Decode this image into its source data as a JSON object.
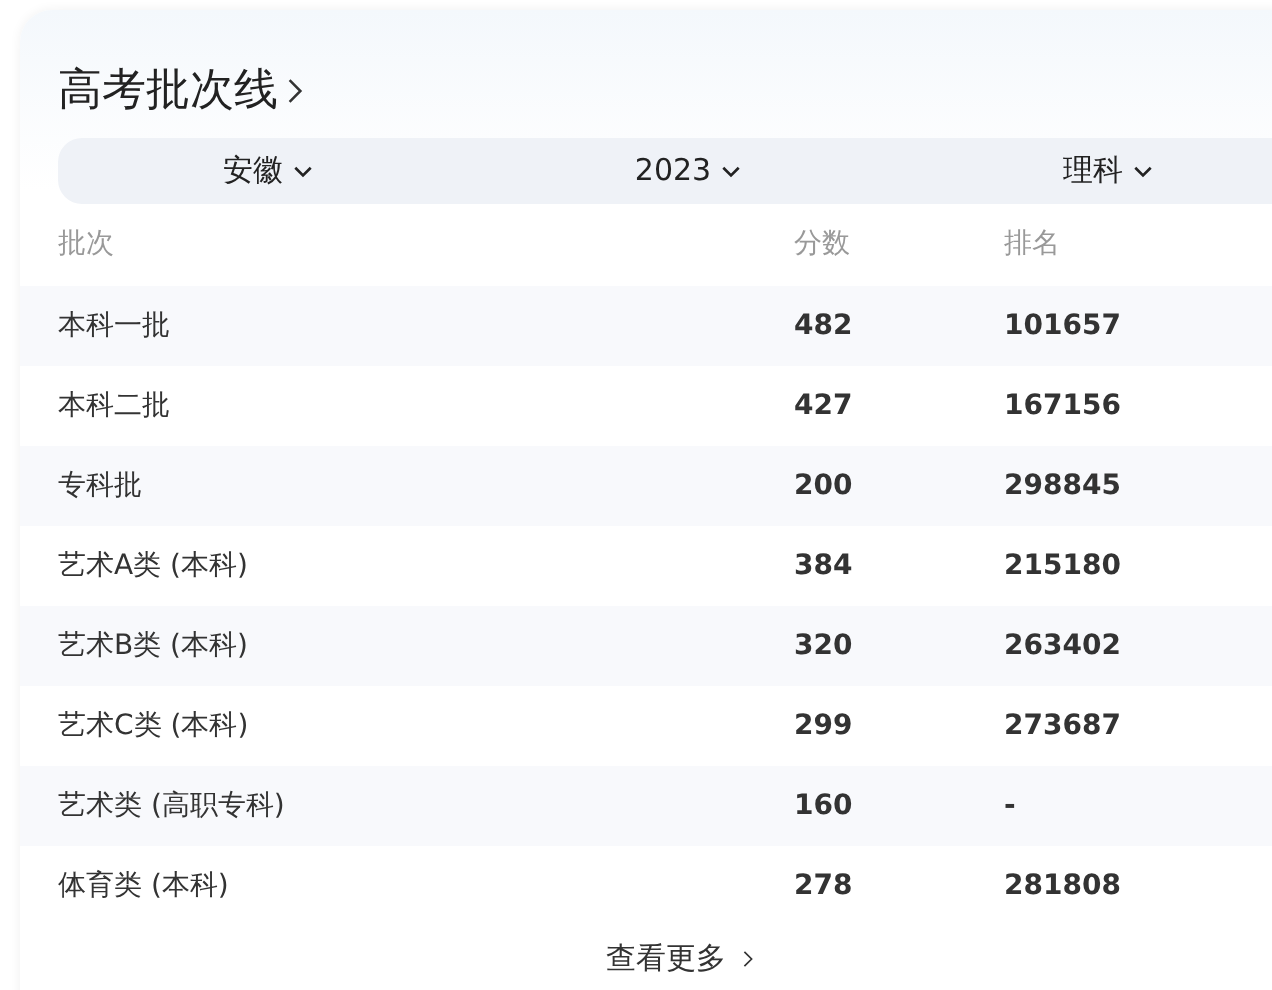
{
  "title": "高考批次线",
  "filters": [
    {
      "label": "安徽"
    },
    {
      "label": "2023"
    },
    {
      "label": "理科"
    }
  ],
  "table": {
    "columns": [
      "批次",
      "分数",
      "排名"
    ],
    "rows": [
      [
        "本科一批",
        "482",
        "101657"
      ],
      [
        "本科二批",
        "427",
        "167156"
      ],
      [
        "专科批",
        "200",
        "298845"
      ],
      [
        "艺术A类 (本科)",
        "384",
        "215180"
      ],
      [
        "艺术B类 (本科)",
        "320",
        "263402"
      ],
      [
        "艺术C类 (本科)",
        "299",
        "273687"
      ],
      [
        "艺术类 (高职专科)",
        "160",
        "-"
      ],
      [
        "体育类 (本科)",
        "278",
        "281808"
      ]
    ]
  },
  "more_link": "查看更多"
}
